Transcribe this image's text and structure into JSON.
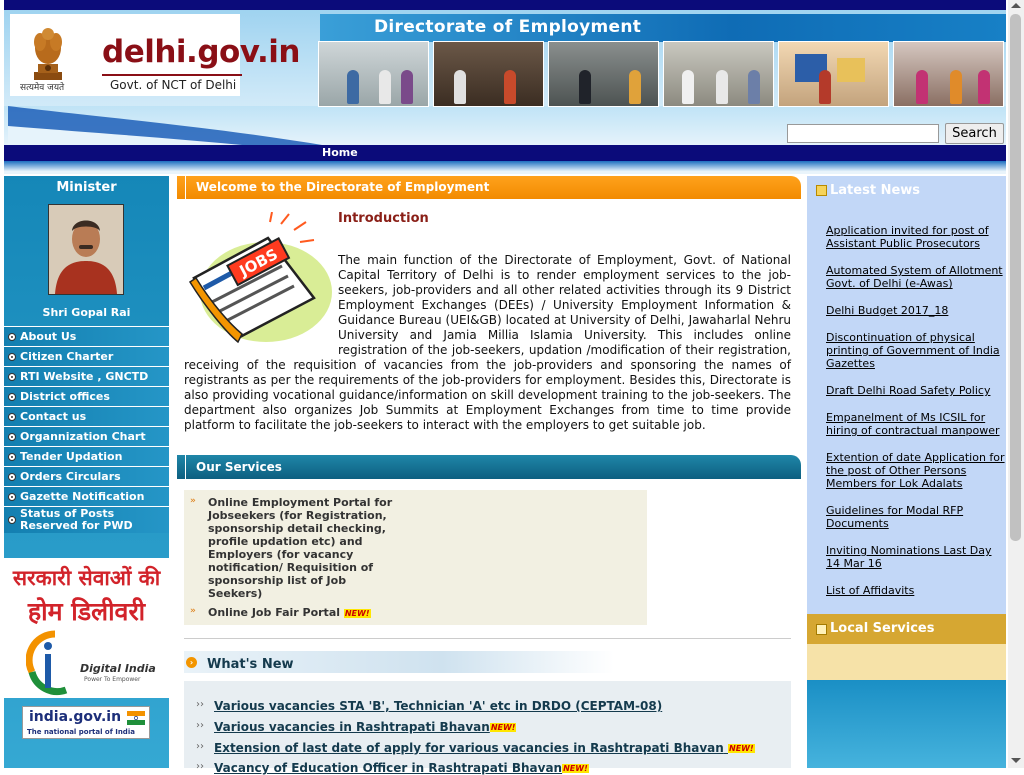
{
  "header": {
    "site_name": "delhi.gov.in",
    "motto": "सत्यमेव जयते",
    "subtitle": "Govt. of NCT of Delhi",
    "directorate_title": "Directorate of Employment",
    "search_button": "Search",
    "search_value": "",
    "nav": [
      "Home"
    ]
  },
  "left": {
    "minister_heading": "Minister",
    "minister_name": "Shri Gopal Rai",
    "menu": [
      "About Us",
      "Citizen Charter",
      "RTI Website , GNCTD",
      "District offices",
      "Contact us",
      "Organnization Chart",
      "Tender Updation",
      "Orders Circulars",
      "Gazette Notification",
      "Status of Posts Reserved for PWD"
    ],
    "home_delivery_line1": "सरकारी सेवाओं की",
    "home_delivery_line2": "होम डिलीवरी",
    "digital_india": "Digital India",
    "digital_india_tagline": "Power To Empower",
    "india_portal_title": "india.gov.in",
    "india_portal_sub": "The national portal of India"
  },
  "main": {
    "welcome_title": "Welcome to the Directorate of Employment",
    "intro_heading": "Introduction",
    "intro_text": "The main function of the Directorate of Employment, Govt. of National Capital Territory of Delhi is to render employment services to the job-seekers, job-providers and all other related activities through its 9 District Employment Exchanges (DEEs) / University Employment Information & Guidance Bureau (UEI&GB) located at University of Delhi, Jawaharlal Nehru University and Jamia Millia Islamia University. This includes online registration of the job-seekers, updation /modification of their registration, receiving of the requisition of vacancies from the job-providers and sponsoring the names of registrants as per the requirements of the job-providers for employment. Besides this, Directorate is also providing vocational guidance/information on skill development training to the job-seekers. The department also organizes Job Summits at Employment Exchanges from time to time provide platform to facilitate the job-seekers to interact with the employers to get suitable job.",
    "jobs_art_label": "JOBS",
    "services_title": "Our Services",
    "services": [
      "Online Employment Portal for Jobseekers (for Registration, sponsorship detail checking, profile updation etc) and Employers (for vacancy notification/ Requisition of sponsorship list of Job Seekers)",
      "Online Job Fair Portal"
    ],
    "new_badge": "NEW!",
    "whatsnew_title": "What's New",
    "whatsnew": [
      "Various vacancies STA 'B', Technician 'A' etc in DRDO (CEPTAM-08)",
      "Various vacancies in Rashtrapati Bhavan",
      "Extension of last date of apply for various vacancies in Rashtrapati Bhavan",
      "Vacancy of Education Officer in Rashtrapati Bhavan"
    ]
  },
  "right": {
    "news_title": "Latest News",
    "news": [
      "Application invited for post of Assistant Public Prosecutors",
      "Automated System of Allotment Govt. of Delhi (e-Awas)",
      "Delhi Budget 2017_18",
      "Discontinuation of physical printing of Government of India Gazettes",
      "Draft Delhi Road Safety Policy",
      "Empanelment of Ms ICSIL for hiring of contractual manpower",
      "Extention of date Application for the post of Other Persons Members for Lok Adalats",
      "Guidelines for Modal RFP Documents",
      "Inviting Nominations Last Day 14 Mar 16",
      "List of Affidavits"
    ],
    "local_title": "Local Services"
  },
  "colors": {
    "navy": "#0b0b7a",
    "orange": "#f39500",
    "teal": "#0d5f80",
    "left_blue": "#1587b8",
    "news_bg": "#c2d7f7",
    "gold": "#d6a732",
    "brand_red": "#8a0f16"
  }
}
